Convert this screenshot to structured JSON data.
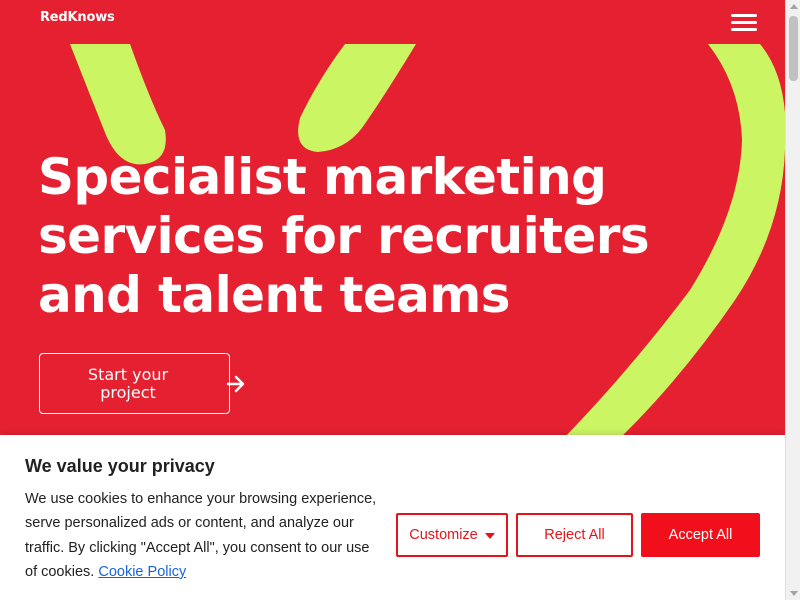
{
  "header": {
    "logo_text": "RedKnows",
    "menu_icon": "hamburger-menu-icon"
  },
  "hero": {
    "title_line1": "Specialist marketing",
    "title_line2": "services for recruiters",
    "title_line3": "and talent teams",
    "cta_label": "Start your project",
    "cta_icon": "arrow-right-icon"
  },
  "cookie_banner": {
    "title": "We value your privacy",
    "body": "We use cookies to enhance your browsing experience, serve personalized ads or content, and analyze our traffic. By clicking \"Accept All\", you consent to our use of cookies.",
    "link_label": "Cookie Policy",
    "customize_label": "Customize",
    "reject_label": "Reject All",
    "accept_label": "Accept All"
  },
  "colors": {
    "brand_red": "#e52030",
    "accent_green": "#ccf564",
    "button_red": "#f00f1a",
    "link_blue": "#1863dc"
  }
}
